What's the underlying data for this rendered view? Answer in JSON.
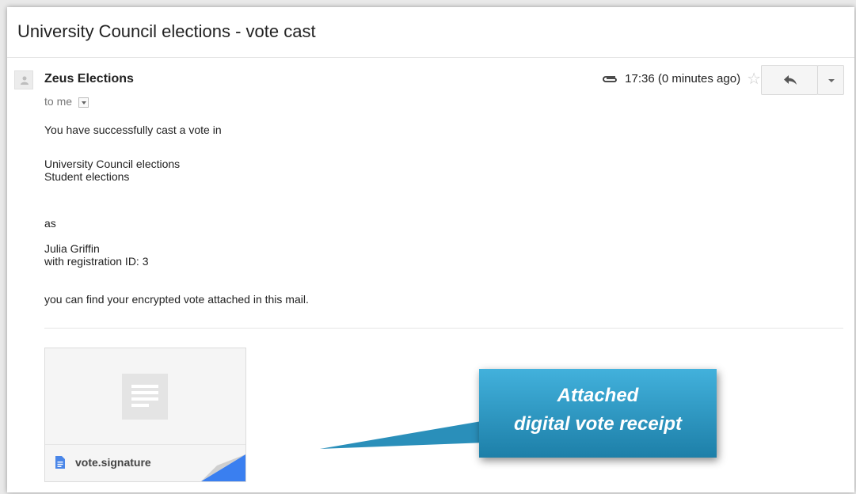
{
  "email": {
    "subject": "University Council elections - vote cast",
    "sender": "Zeus Elections",
    "recipient": "to me",
    "time": "17:36 (0 minutes ago)",
    "body": {
      "line1": "You have successfully cast a vote in",
      "election_line1": "University Council elections",
      "election_line2": "Student elections",
      "as": "as",
      "voter_name": "Julia Griffin",
      "voter_id": "with registration ID: 3",
      "closing": "you can find your encrypted vote attached in this mail."
    },
    "attachment": {
      "filename": "vote.signature",
      "icon": "document-icon"
    }
  },
  "callout": {
    "line1": "Attached",
    "line2": "digital vote receipt"
  },
  "icons": {
    "attachment": "paperclip-icon",
    "star": "star-icon",
    "reply": "reply-icon",
    "more": "chevron-down-icon"
  },
  "colors": {
    "callout": "#2a95c4",
    "corner": "#3a7ff0"
  }
}
